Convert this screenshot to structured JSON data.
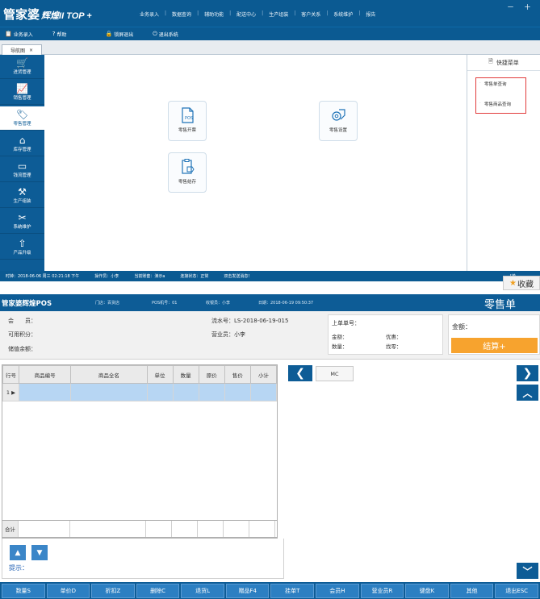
{
  "top_window": {
    "logo": "管家婆",
    "logo_version": "辉煌II TOP +",
    "menu": [
      "业务录入",
      "数据查询",
      "辅助功能",
      "配送中心",
      "生产组装",
      "客户关系",
      "系统维护",
      "报告"
    ],
    "window_controls": [
      "－",
      "＋"
    ],
    "toolbar": [
      {
        "icon": "clipboard-icon",
        "label": "业务录入"
      },
      {
        "icon": "help-icon",
        "label": "帮助"
      },
      {
        "icon": "lock-icon",
        "label": "锁屏退出"
      },
      {
        "icon": "power-icon",
        "label": "退出系统"
      }
    ],
    "nav_tab": {
      "label": "导航图",
      "close": "×"
    },
    "sidebar": [
      {
        "icon": "cart-icon",
        "label": "进货管理"
      },
      {
        "icon": "trend-chart-icon",
        "label": "销售管理"
      },
      {
        "icon": "tag-icon",
        "label": "零售管理"
      },
      {
        "icon": "warehouse-icon",
        "label": "库存管理"
      },
      {
        "icon": "money-icon",
        "label": "钱流管理"
      },
      {
        "icon": "tools-icon",
        "label": "生产组装"
      },
      {
        "icon": "wrench-icon",
        "label": "系统维护"
      },
      {
        "icon": "upgrade-icon",
        "label": "产品升级"
      }
    ],
    "cards": [
      {
        "icon": "pos-doc-icon",
        "label": "零售开票"
      },
      {
        "icon": "gear-tag-icon",
        "label": "零售设置"
      },
      {
        "icon": "clipboard-tag-icon",
        "label": "零售结存"
      }
    ],
    "quick_menu": {
      "title": "快捷菜单",
      "items": [
        "零售单查询",
        "零售商品查询"
      ]
    },
    "status_bar": [
      "时钟：2018-06-06 周三 02:21:18 下午",
      "操作员：小李",
      "当前账套：演示a",
      "连接状态：正常",
      "双击发送消息！",
      "[单"
    ]
  },
  "favorite_button": {
    "label": "收藏",
    "icon": "star-icon"
  },
  "pos_window": {
    "name": "管家婆辉煌POS",
    "store": "门店：百货店",
    "machine": "POS机号：01",
    "cashier": "收银员：小李",
    "date": "日期：2018-06-19 09:50:37",
    "title": "零售单",
    "member_label": "会　　员：",
    "points_label": "可用积分：",
    "balance_label": "储值余额：",
    "serial_label": "流水号：",
    "serial_value": "LS-2018-06-19-015",
    "sales_label": "营业员：",
    "sales_value": "小李",
    "last_order_label": "上单单号：",
    "amount_label": "金额：",
    "discount_label": "优惠：",
    "qty_label": "数量：",
    "change_label": "找零：",
    "total_amount_label": "金额：",
    "settle_button": "结算+",
    "grid": {
      "columns": [
        "行号",
        "商品编号",
        "商品全名",
        "单位",
        "数量",
        "原价",
        "售价",
        "小计"
      ],
      "rows": [
        [
          "1 ▶",
          "",
          "",
          "",
          "",
          "",
          "",
          ""
        ]
      ]
    },
    "total_row_label": "合计",
    "mc_button": "MC",
    "hint_label": "提示：",
    "function_keys": [
      "数量S",
      "单价D",
      "折扣Z",
      "删除C",
      "退货L",
      "赠品F4",
      "挂单T",
      "会员H",
      "营业员R",
      "键盘K",
      "其他",
      "退出ESC"
    ]
  }
}
